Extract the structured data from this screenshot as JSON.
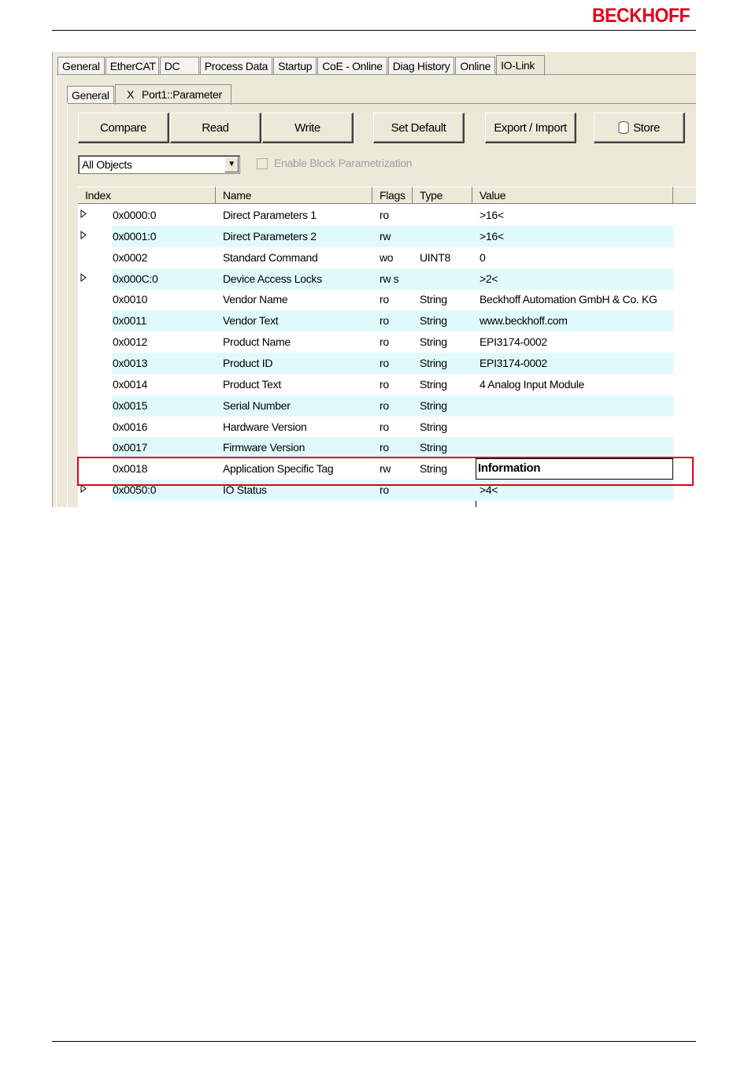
{
  "brand": {
    "logo_text": "BECKHOFF",
    "color": "#e2001a"
  },
  "outer_tabs": [
    "General",
    "EtherCAT",
    "DC",
    "Process Data",
    "Startup",
    "CoE - Online",
    "Diag History",
    "Online",
    "IO-Link"
  ],
  "outer_active": "IO-Link",
  "inner_tabs": {
    "general": "General",
    "close_glyph": "X",
    "port": "Port1::Parameter"
  },
  "buttons": {
    "compare": "Compare",
    "read": "Read",
    "write": "Write",
    "set_default": "Set Default",
    "export_import": "Export / Import",
    "store": "Store"
  },
  "filter": {
    "selected": "All Objects",
    "checkbox_label": "Enable Block Parametrization",
    "checked": false
  },
  "table": {
    "headers": {
      "index": "Index",
      "name": "Name",
      "flags": "Flags",
      "type": "Type",
      "value": "Value"
    },
    "rows": [
      {
        "expand": true,
        "index": "0x0000:0",
        "name": "Direct Parameters 1",
        "flags": "ro",
        "type": "",
        "value": ">16<"
      },
      {
        "expand": true,
        "index": "0x0001:0",
        "name": "Direct Parameters 2",
        "flags": "rw",
        "type": "",
        "value": ">16<"
      },
      {
        "expand": false,
        "index": "0x0002",
        "name": "Standard Command",
        "flags": "wo",
        "type": "UINT8",
        "value": "0"
      },
      {
        "expand": true,
        "index": "0x000C:0",
        "name": "Device Access Locks",
        "flags": "rw s",
        "type": "",
        "value": ">2<"
      },
      {
        "expand": false,
        "index": "0x0010",
        "name": "Vendor Name",
        "flags": "ro",
        "type": "String",
        "value": "Beckhoff Automation GmbH & Co. KG"
      },
      {
        "expand": false,
        "index": "0x0011",
        "name": "Vendor Text",
        "flags": "ro",
        "type": "String",
        "value": "www.beckhoff.com"
      },
      {
        "expand": false,
        "index": "0x0012",
        "name": "Product Name",
        "flags": "ro",
        "type": "String",
        "value": "EPI3174-0002"
      },
      {
        "expand": false,
        "index": "0x0013",
        "name": "Product ID",
        "flags": "ro",
        "type": "String",
        "value": "EPI3174-0002"
      },
      {
        "expand": false,
        "index": "0x0014",
        "name": "Product Text",
        "flags": "ro",
        "type": "String",
        "value": "4 Analog Input Module"
      },
      {
        "expand": false,
        "index": "0x0015",
        "name": "Serial Number",
        "flags": "ro",
        "type": "String",
        "value": ""
      },
      {
        "expand": false,
        "index": "0x0016",
        "name": "Hardware Version",
        "flags": "ro",
        "type": "String",
        "value": ""
      },
      {
        "expand": false,
        "index": "0x0017",
        "name": "Firmware Version",
        "flags": "ro",
        "type": "String",
        "value": ""
      },
      {
        "expand": false,
        "index": "0x0018",
        "name": "Application Specific Tag",
        "flags": "rw",
        "type": "String",
        "value": "Information",
        "editing": true
      },
      {
        "expand": true,
        "index": "0x0050:0",
        "name": "IO Status",
        "flags": "ro",
        "type": "",
        "value": ">4<"
      }
    ]
  }
}
